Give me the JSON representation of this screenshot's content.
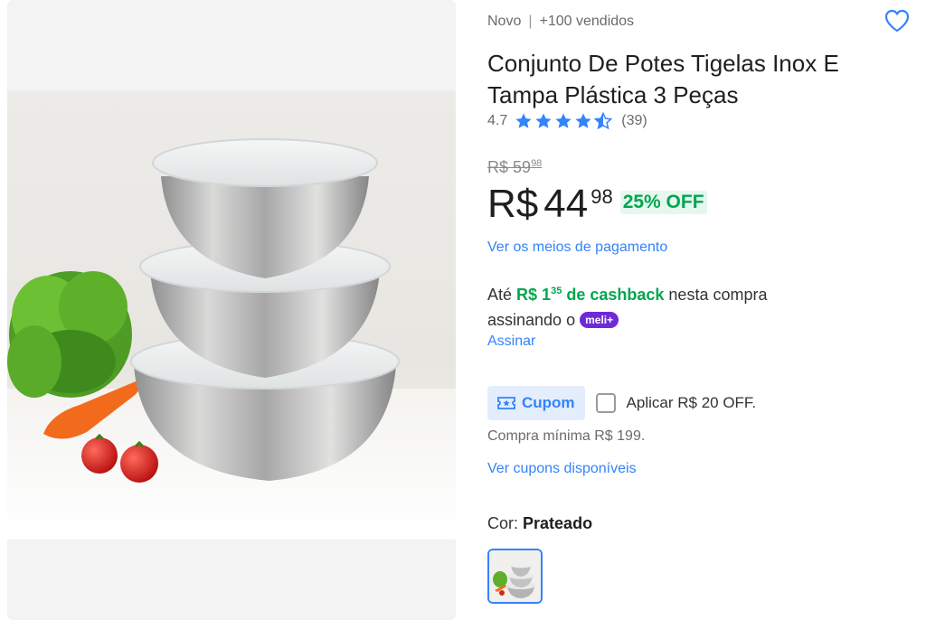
{
  "product": {
    "condition": "Novo",
    "sold": "+100 vendidos",
    "title": "Conjunto De Potes Tigelas Inox E Tampa Plástica 3 Peças",
    "rating": "4.7",
    "rating_value": 4.7,
    "review_count": "(39)",
    "image_alt": "Tigelas de inox com tampas plásticas"
  },
  "price": {
    "old_currency": "R$",
    "old_int": "59",
    "old_cents": "98",
    "currency": "R$",
    "int": "44",
    "cents": "98",
    "discount": "25% OFF"
  },
  "links": {
    "payment": "Ver os meios de pagamento",
    "subscribe": "Assinar",
    "coupons": "Ver cupons disponíveis"
  },
  "cashback": {
    "prefix": "Até",
    "amount_currency": "R$ 1",
    "amount_cents": "35",
    "label": "de cashback",
    "suffix": "nesta compra",
    "line2": "assinando o",
    "badge": "meli+"
  },
  "coupon": {
    "button_label": "Cupom",
    "apply_label": "Aplicar R$ 20 OFF.",
    "min_purchase": "Compra mínima R$ 199."
  },
  "variant": {
    "label": "Cor:",
    "value": "Prateado"
  },
  "icons": {
    "favorite": "heart-outline-icon",
    "coupon": "ticket-icon",
    "star": "star-icon"
  },
  "colors": {
    "accent": "#3483fa",
    "green": "#00a650",
    "meli_purple": "#6f2ad7"
  }
}
